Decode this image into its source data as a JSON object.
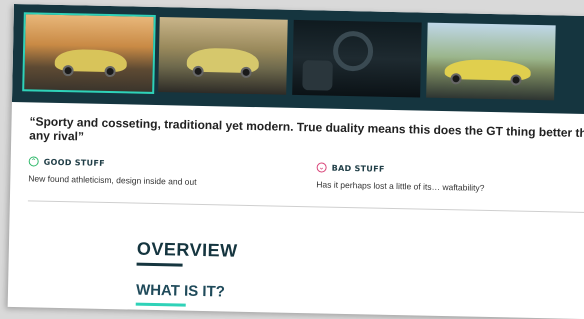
{
  "gallery": {
    "thumbnails": [
      {
        "name": "gallery-thumb-1",
        "description": "yellow coupe on road at sunset",
        "selected": true
      },
      {
        "name": "gallery-thumb-2",
        "description": "yellow coupe rear view"
      },
      {
        "name": "gallery-thumb-3",
        "description": "car interior"
      },
      {
        "name": "gallery-thumb-4",
        "description": "yellow coupe side view"
      }
    ]
  },
  "review": {
    "quote": "“Sporty and cosseting, traditional yet modern. True duality means this does the GT thing better tha any rival”",
    "good": {
      "label": "GOOD STUFF",
      "text": "New found athleticism, design inside and out"
    },
    "bad": {
      "label": "BAD STUFF",
      "text": "Has it perhaps lost a little of its… waftability?"
    }
  },
  "sections": {
    "overview": "OVERVIEW",
    "what_is_it": "WHAT IS IT?"
  },
  "colors": {
    "gallery_bg": "#15353f",
    "accent": "#2fd2b8",
    "good": "#2fb86a",
    "bad": "#d9467a"
  }
}
